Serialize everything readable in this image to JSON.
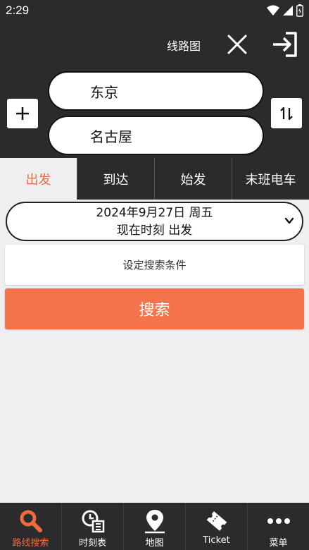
{
  "status_bar": {
    "time": "2:29"
  },
  "header": {
    "title": "线路图"
  },
  "route": {
    "from": "东京",
    "to": "名古屋"
  },
  "tabs": [
    {
      "label": "出发",
      "active": true
    },
    {
      "label": "到达",
      "active": false
    },
    {
      "label": "始发",
      "active": false
    },
    {
      "label": "末班电车",
      "active": false
    }
  ],
  "datetime": {
    "date": "2024年9月27日 周五",
    "mode": "现在时刻 出发"
  },
  "conditions_label": "设定搜索条件",
  "search_label": "搜索",
  "nav": [
    {
      "label": "路线搜索",
      "icon": "search-icon",
      "active": true
    },
    {
      "label": "时刻表",
      "icon": "timetable-icon",
      "active": false
    },
    {
      "label": "地图",
      "icon": "map-pin-icon",
      "active": false
    },
    {
      "label": "Ticket",
      "icon": "ticket-icon",
      "active": false
    },
    {
      "label": "菜单",
      "icon": "more-icon",
      "active": false
    }
  ],
  "colors": {
    "dark": "#2b2b2e",
    "accent": "#ee6a40",
    "button": "#f5734a",
    "background": "#efeff1"
  }
}
